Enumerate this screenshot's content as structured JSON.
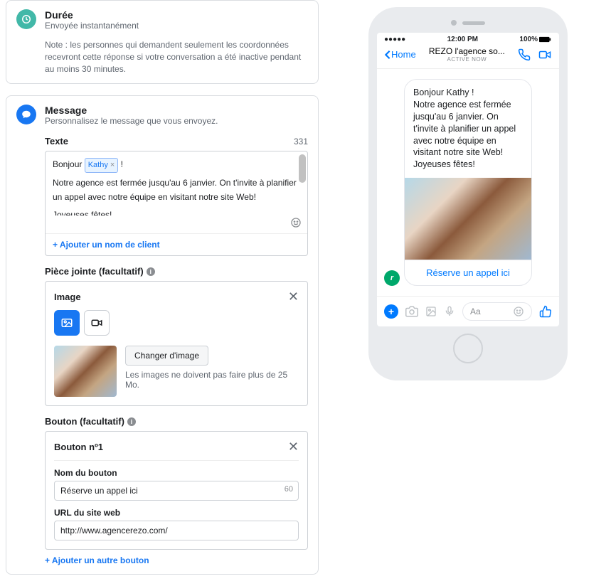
{
  "duree": {
    "title": "Durée",
    "subtitle": "Envoyée instantanément",
    "note": "Note : les personnes qui demandent seulement les coordonnées recevront cette réponse si votre conversation a été inactive pendant au moins 30 minutes."
  },
  "message": {
    "title": "Message",
    "subtitle": "Personnalisez le message que vous envoyez.",
    "texte_label": "Texte",
    "texte_counter": "331",
    "greeting_prefix": "Bonjour",
    "token_name": "Kathy",
    "greeting_suffix": "!",
    "body_line1": "Notre agence est fermée jusqu'au 6 janvier. On t'invite à planifier un appel avec notre équipe en visitant notre site Web!",
    "body_line2": "Joyeuses fêtes!",
    "add_client": "+ Ajouter un nom de client",
    "piece_jointe_label": "Pièce jointe (facultatif)",
    "image_label": "Image",
    "change_image": "Changer d'image",
    "image_hint": "Les images ne doivent pas faire plus de 25 Mo.",
    "bouton_label": "Bouton (facultatif)",
    "bouton_num": "Bouton nº1",
    "nom_bouton_label": "Nom du bouton",
    "nom_bouton_value": "Réserve un appel ici",
    "nom_bouton_counter": "60",
    "url_label": "URL du site web",
    "url_value": "http://www.agencerezo.com/",
    "add_button": "+ Ajouter un autre bouton"
  },
  "preview": {
    "time": "12:00 PM",
    "battery": "100%",
    "home": "Home",
    "title": "REZO l'agence so...",
    "active": "Active now",
    "bubble_text": "Bonjour Kathy !\nNotre agence est fermée jusqu'au 6 janvier. On t'invite à planifier un appel avec notre équipe en visitant notre site Web!\nJoyeuses fêtes!",
    "bubble_button": "Réserve un appel ici",
    "composer_placeholder": "Aa",
    "avatar_letter": "r"
  }
}
